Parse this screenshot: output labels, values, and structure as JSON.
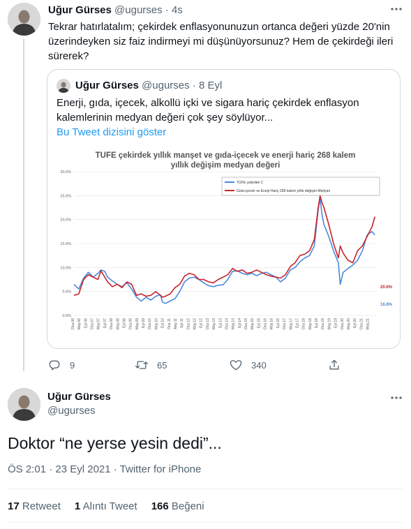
{
  "colors": {
    "text": "#0f1419",
    "muted": "#536471",
    "link": "#1d9bf0",
    "border": "#cfd9de",
    "series_tufe": "#4a89dc",
    "series_median": "#c8232c"
  },
  "reply_tweet": {
    "name": "Uğur Gürses",
    "handle": "@ugurses",
    "dot": "·",
    "time": "4s",
    "more_icon": "more-dots-icon",
    "text": "Tekrar hatırlatalım; çekirdek enflasyonunuzun ortanca değeri yüzde 20'nin üzerindeyken siz faiz indirmeyi mi düşünüyorsunuz? Hem de çekirdeği ileri sürerek?"
  },
  "quoted_tweet": {
    "name": "Uğur Gürses",
    "handle": "@ugurses",
    "dot": "·",
    "time": "8 Eyl",
    "text": "Enerji, gıda, içecek, alkollü içki ve sigara hariç çekirdek enflasyon kalemlerinin medyan değeri çok şey söylüyor...",
    "show_thread": "Bu Tweet dizisini göster"
  },
  "actions": {
    "reply_count": "9",
    "retweet_count": "65",
    "like_count": "340",
    "reply_icon": "reply-icon",
    "retweet_icon": "retweet-icon",
    "like_icon": "heart-icon",
    "share_icon": "share-icon"
  },
  "main_tweet": {
    "name": "Uğur Gürses",
    "handle": "@ugurses",
    "text": "Doktor “ne yerse yesin dedi”...",
    "timestamp": "ÖS 2:01 · 23 Eyl 2021 · Twitter for iPhone",
    "stats": [
      {
        "count": "17",
        "label": "Retweet"
      },
      {
        "count": "1",
        "label": "Alıntı Tweet"
      },
      {
        "count": "166",
        "label": "Beğeni"
      }
    ]
  },
  "chart_data": {
    "type": "line",
    "title": "TUFE çekirdek yıllık manşet ve  gıda-içecek ve enerji hariç 268 kalem yıllık değişim medyan değeri",
    "title_line1": "TUFE çekirdek yıllık manşet ve  gıda-içecek ve enerji hariç 268 kalem",
    "title_line2": "yıllık değişim medyan değeri",
    "y_ticks": [
      "0.0%",
      "5.0%",
      "10.0%",
      "15.0%",
      "20.0%",
      "25.0%",
      "30.0%"
    ],
    "ylim": [
      0,
      30
    ],
    "grid": true,
    "legend_position": "top-right",
    "x_ticks": [
      "Oca.06",
      "May.06",
      "Eyl.06",
      "Oca.07",
      "May.07",
      "Eyl.07",
      "Oca.08",
      "May.08",
      "Eyl.08",
      "Oca.09",
      "May.09",
      "Eyl.09",
      "Oca.10",
      "May.10",
      "Eyl.10",
      "Oca.11",
      "May.11",
      "Eyl.11",
      "Oca.12",
      "May.12",
      "Eyl.12",
      "Oca.13",
      "May.13",
      "Eyl.13",
      "Oca.14",
      "May.14",
      "Eyl.14",
      "Oca.15",
      "May.15",
      "Eyl.15",
      "Oca.16",
      "May.16",
      "Eyl.16",
      "Oca.17",
      "May.17",
      "Eyl.17",
      "Oca.18",
      "May.18",
      "Eyl.18",
      "Oca.19",
      "May.19",
      "Eyl.19",
      "Oca.20",
      "May.20",
      "Eyl.20",
      "Oca.21",
      "May.21"
    ],
    "series": [
      {
        "name": "TÜFE çekirdek C",
        "end_label": "16.8%",
        "points": [
          [
            2006.0,
            6.5
          ],
          [
            2006.25,
            5.5
          ],
          [
            2006.5,
            7.8
          ],
          [
            2006.75,
            9.0
          ],
          [
            2007.0,
            8.0
          ],
          [
            2007.25,
            8.8
          ],
          [
            2007.4,
            9.5
          ],
          [
            2007.6,
            9.2
          ],
          [
            2007.75,
            8.0
          ],
          [
            2008.0,
            7.2
          ],
          [
            2008.25,
            6.5
          ],
          [
            2008.5,
            6.0
          ],
          [
            2008.75,
            6.8
          ],
          [
            2009.0,
            5.5
          ],
          [
            2009.25,
            3.8
          ],
          [
            2009.5,
            3.0
          ],
          [
            2009.75,
            3.8
          ],
          [
            2010.0,
            3.2
          ],
          [
            2010.25,
            4.0
          ],
          [
            2010.5,
            4.3
          ],
          [
            2010.6,
            2.8
          ],
          [
            2010.75,
            2.5
          ],
          [
            2011.0,
            3.0
          ],
          [
            2011.25,
            3.5
          ],
          [
            2011.5,
            5.0
          ],
          [
            2011.75,
            7.0
          ],
          [
            2012.0,
            7.8
          ],
          [
            2012.25,
            8.0
          ],
          [
            2012.5,
            7.5
          ],
          [
            2012.75,
            6.8
          ],
          [
            2013.0,
            6.2
          ],
          [
            2013.25,
            6.0
          ],
          [
            2013.5,
            6.3
          ],
          [
            2013.75,
            6.4
          ],
          [
            2014.0,
            7.5
          ],
          [
            2014.25,
            9.2
          ],
          [
            2014.5,
            9.3
          ],
          [
            2014.75,
            8.8
          ],
          [
            2015.0,
            8.5
          ],
          [
            2015.25,
            8.8
          ],
          [
            2015.5,
            8.3
          ],
          [
            2015.75,
            8.8
          ],
          [
            2016.0,
            9.0
          ],
          [
            2016.25,
            8.5
          ],
          [
            2016.5,
            8.0
          ],
          [
            2016.75,
            7.0
          ],
          [
            2017.0,
            7.8
          ],
          [
            2017.25,
            9.5
          ],
          [
            2017.5,
            10.0
          ],
          [
            2017.75,
            11.2
          ],
          [
            2018.0,
            12.0
          ],
          [
            2018.25,
            12.5
          ],
          [
            2018.5,
            14.5
          ],
          [
            2018.7,
            22.0
          ],
          [
            2018.8,
            24.5
          ],
          [
            2018.9,
            21.0
          ],
          [
            2019.0,
            19.0
          ],
          [
            2019.25,
            16.5
          ],
          [
            2019.5,
            13.5
          ],
          [
            2019.75,
            11.0
          ],
          [
            2019.85,
            6.5
          ],
          [
            2020.0,
            9.0
          ],
          [
            2020.25,
            9.8
          ],
          [
            2020.5,
            10.5
          ],
          [
            2020.75,
            11.5
          ],
          [
            2021.0,
            13.5
          ],
          [
            2021.25,
            16.8
          ],
          [
            2021.5,
            17.5
          ],
          [
            2021.65,
            16.8
          ]
        ]
      },
      {
        "name": "Gıda-içecek ve Enerji Hariç 268 kalem yıllık değişim Medyan",
        "end_label": "20.6%",
        "points": [
          [
            2006.0,
            4.2
          ],
          [
            2006.25,
            4.5
          ],
          [
            2006.5,
            7.5
          ],
          [
            2006.75,
            8.5
          ],
          [
            2007.0,
            8.0
          ],
          [
            2007.25,
            7.5
          ],
          [
            2007.4,
            9.3
          ],
          [
            2007.6,
            8.0
          ],
          [
            2007.75,
            7.0
          ],
          [
            2008.0,
            6.0
          ],
          [
            2008.25,
            6.5
          ],
          [
            2008.5,
            5.8
          ],
          [
            2008.75,
            7.0
          ],
          [
            2009.0,
            6.5
          ],
          [
            2009.25,
            4.2
          ],
          [
            2009.5,
            4.5
          ],
          [
            2009.75,
            4.0
          ],
          [
            2010.0,
            4.2
          ],
          [
            2010.25,
            5.0
          ],
          [
            2010.5,
            4.2
          ],
          [
            2010.6,
            3.8
          ],
          [
            2010.75,
            4.0
          ],
          [
            2011.0,
            4.5
          ],
          [
            2011.25,
            5.8
          ],
          [
            2011.5,
            6.5
          ],
          [
            2011.75,
            8.2
          ],
          [
            2012.0,
            8.8
          ],
          [
            2012.25,
            8.5
          ],
          [
            2012.5,
            7.5
          ],
          [
            2012.75,
            7.5
          ],
          [
            2013.0,
            7.0
          ],
          [
            2013.25,
            6.8
          ],
          [
            2013.5,
            7.5
          ],
          [
            2013.75,
            8.0
          ],
          [
            2014.0,
            8.5
          ],
          [
            2014.25,
            9.8
          ],
          [
            2014.5,
            9.2
          ],
          [
            2014.75,
            9.5
          ],
          [
            2015.0,
            8.8
          ],
          [
            2015.25,
            9.0
          ],
          [
            2015.5,
            9.5
          ],
          [
            2015.75,
            9.0
          ],
          [
            2016.0,
            8.5
          ],
          [
            2016.25,
            8.2
          ],
          [
            2016.5,
            8.0
          ],
          [
            2016.75,
            7.8
          ],
          [
            2017.0,
            8.5
          ],
          [
            2017.25,
            10.2
          ],
          [
            2017.5,
            11.0
          ],
          [
            2017.75,
            12.5
          ],
          [
            2018.0,
            12.8
          ],
          [
            2018.25,
            13.5
          ],
          [
            2018.5,
            15.8
          ],
          [
            2018.7,
            22.5
          ],
          [
            2018.8,
            25.0
          ],
          [
            2018.9,
            23.5
          ],
          [
            2019.0,
            22.5
          ],
          [
            2019.25,
            19.0
          ],
          [
            2019.5,
            15.0
          ],
          [
            2019.75,
            12.0
          ],
          [
            2019.85,
            14.5
          ],
          [
            2020.0,
            13.0
          ],
          [
            2020.25,
            11.5
          ],
          [
            2020.5,
            11.0
          ],
          [
            2020.75,
            13.5
          ],
          [
            2021.0,
            14.5
          ],
          [
            2021.25,
            16.5
          ],
          [
            2021.5,
            18.5
          ],
          [
            2021.65,
            20.6
          ]
        ]
      }
    ]
  }
}
